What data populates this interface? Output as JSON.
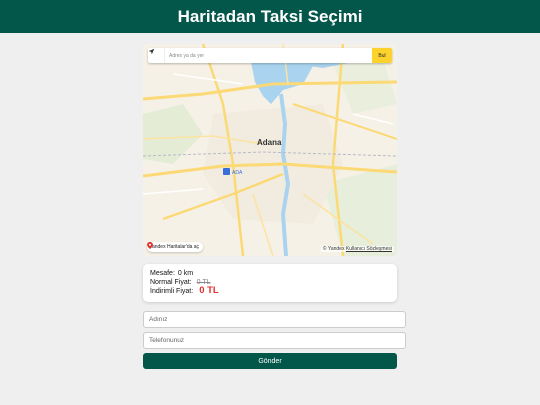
{
  "header": {
    "title": "Haritadan Taksi Seçimi"
  },
  "map": {
    "search_placeholder": "Adres ya da yer",
    "find_label": "Bul",
    "city_label": "Adana",
    "open_in_yandex": "Yandex Haritalar'da aç",
    "attribution_prefix": "© Yandex",
    "terms_link": "Kullanıcı Sözleşmesi",
    "place_labels": [
      "ADA"
    ]
  },
  "price": {
    "distance_label": "Mesafe:",
    "distance_value": "0 km",
    "normal_label": "Normal Fiyat:",
    "normal_value": "0 TL",
    "discount_label": "İndirimli Fiyat:",
    "discount_value": "0 TL"
  },
  "form": {
    "name_placeholder": "Adınız",
    "phone_placeholder": "Telefonunuz",
    "submit_label": "Gönder"
  },
  "colors": {
    "header_bg": "#03574a",
    "button_bg": "#03574a",
    "discount_price": "#e0302e",
    "find_button": "#fdd22c"
  }
}
